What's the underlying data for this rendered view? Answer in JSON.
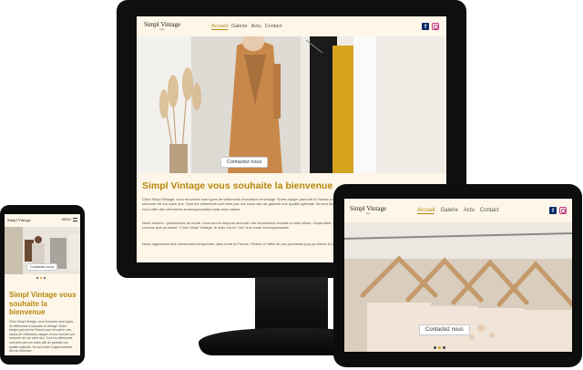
{
  "site": {
    "logo": "Simpl Vintage",
    "logo_sub": "luxe",
    "nav": [
      "Accueil",
      "Galerie",
      "Actu",
      "Contact"
    ],
    "cta": "Contactez nous",
    "headline": "Simpl Vintage vous souhaite la bienvenue",
    "paragraph_1": "Chez Simpl Vintage, vous trouverez tous types de vêtements d'occasion et vintage. Notre équipe parcourt la France pour récupérer des stocks de vêtements usagés, et leur donner une seconde vie sur votre dos. Tous les vêtements sont triés par nos soins afin de garantir une qualité optimale. Ils sont lavés soigneusement afin de redonner l'éclat de leur jeunesse et vous offrir des vêtements écoresponsables mais avec classe.",
    "paragraph_2": "Notre histoire : passionnés de mode, nous avons toujours accordé une importance cruciale à notre allure. Cependant, l'industrie du textile est une des plus polluantes au monde. Nous voulons que ça cesse ! Chez Simpl Vintage, le style est du \"oui\" à la mode écoresponsable.",
    "paragraph_3": "Nous organisons des showrooms temporaire dans toute la France. Restez à l'affût de nos prochains pop-up stores à Lille, à Marseille, à Paris ou encore à Strasbourg !",
    "phone_menu": "MENU",
    "phone_paragraph": "Chez Simpl Vintage, vous trouverez tous types de vêtements d'occasion et vintage. Notre équipe parcourt la France pour récupérer des stocks de vêtements usagés, et leur donner une seconde vie sur votre dos. Tous les vêtements sont triés par nos soins afin de garantir une qualité optimale. Ils sont lavés soigneusement afin de redonner"
  },
  "colors": {
    "accent": "#b8860b",
    "page_bg": "#fdf6e9",
    "device": "#0d0d0d"
  },
  "icons": [
    "facebook-icon",
    "instagram-icon",
    "hamburger-icon"
  ]
}
